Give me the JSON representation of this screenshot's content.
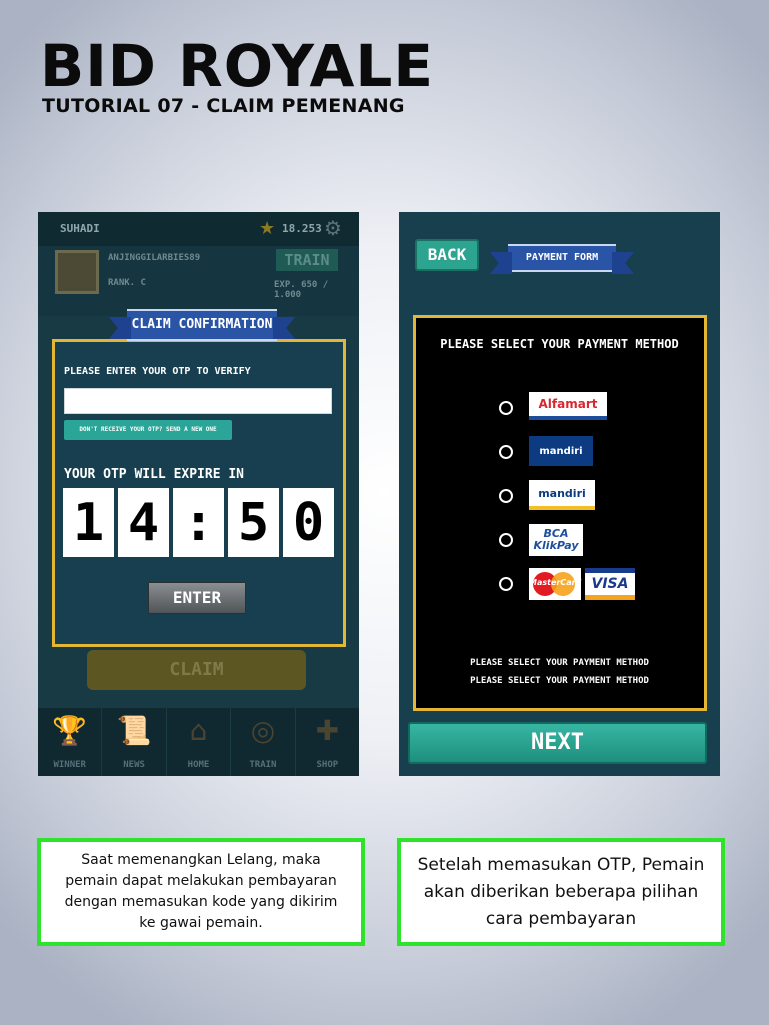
{
  "header": {
    "title": "BID ROYALE",
    "subtitle": "TUTORIAL 07 - CLAIM PEMENANG"
  },
  "left_screen": {
    "topbar": {
      "player_name": "SUHADI",
      "coins": "18.253"
    },
    "profile": {
      "username": "ANJINGGILARBIES89",
      "rank": "RANK. C",
      "train_button": "TRAIN",
      "exp": "EXP. 650 / 1.000"
    },
    "dialog": {
      "title": "CLAIM CONFIRMATION",
      "otp_prompt": "PLEASE ENTER YOUR OTP TO VERIFY",
      "otp_value": "",
      "resend_button": "DON'T RECEIVE YOUR OTP? SEND A NEW ONE",
      "expire_label": "YOUR OTP WILL EXPIRE IN",
      "timer": [
        "1",
        "4",
        ":",
        "5",
        "0"
      ],
      "enter_button": "ENTER"
    },
    "claim_button": "CLAIM",
    "nav": [
      {
        "label": "WINNER",
        "icon": "trophy-icon"
      },
      {
        "label": "NEWS",
        "icon": "scroll-icon"
      },
      {
        "label": "HOME",
        "icon": "home-icon"
      },
      {
        "label": "TRAIN",
        "icon": "target-icon"
      },
      {
        "label": "SHOP",
        "icon": "shop-icon"
      }
    ]
  },
  "right_screen": {
    "back_button": "BACK",
    "title": "PAYMENT FORM",
    "heading": "PLEASE SELECT YOUR PAYMENT METHOD",
    "methods": [
      {
        "name": "Alfamart",
        "selected": false
      },
      {
        "name": "mandiri e-cash",
        "selected": false
      },
      {
        "name": "mandiri e-cash",
        "selected": false
      },
      {
        "name": "BCA KlikPay",
        "selected": false
      },
      {
        "name": "MasterCard / VISA",
        "selected": false
      }
    ],
    "logos": {
      "alfamart": "Alfamart",
      "mandiri_small": "mandiri",
      "mandiri": "mandiri",
      "bca_line1": "BCA",
      "bca_line2": "KlikPay",
      "mastercard": "MasterCard",
      "visa": "VISA"
    },
    "footer_notes": [
      "PLEASE SELECT YOUR PAYMENT METHOD",
      "PLEASE SELECT YOUR PAYMENT METHOD"
    ],
    "next_button": "NEXT"
  },
  "captions": {
    "left": "Saat memenangkan Lelang, maka pemain dapat melakukan pembayaran dengan memasukan kode yang dikirim ke gawai pemain.",
    "right": "Setelah memasukan OTP, Pemain akan diberikan beberapa pilihan cara pembayaran"
  },
  "colors": {
    "accent_border": "#e3b733",
    "caption_border": "#2ee32b",
    "button_teal": "#2ca48f",
    "ribbon_blue": "#2a54a6"
  }
}
